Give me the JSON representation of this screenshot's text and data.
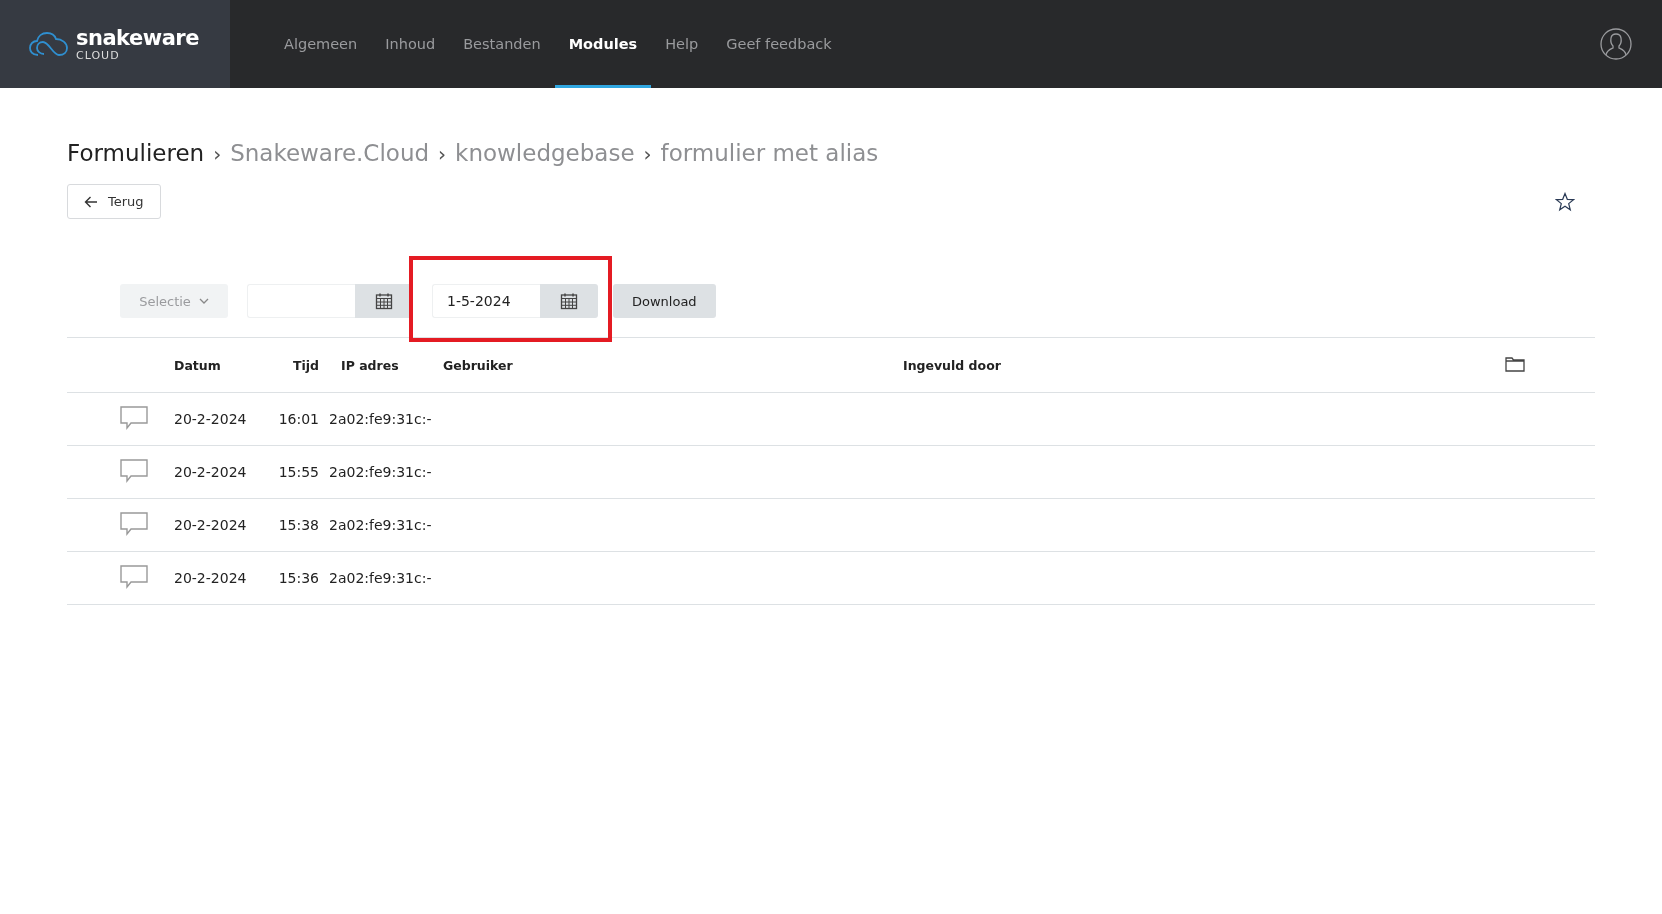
{
  "logo": {
    "name": "snakeware",
    "sub": "CLOUD"
  },
  "nav": [
    {
      "label": "Algemeen",
      "selected": false
    },
    {
      "label": "Inhoud",
      "selected": false
    },
    {
      "label": "Bestanden",
      "selected": false
    },
    {
      "label": "Modules",
      "selected": true
    },
    {
      "label": "Help",
      "selected": false
    },
    {
      "label": "Geef feedback",
      "selected": false
    }
  ],
  "breadcrumb": [
    {
      "label": "Formulieren",
      "current": true
    },
    {
      "label": "Snakeware.Cloud",
      "current": false
    },
    {
      "label": "knowledgebase",
      "current": false
    },
    {
      "label": "formulier met alias",
      "current": false
    }
  ],
  "breadcrumb_separator": "›",
  "back_button": "Terug",
  "favorite": false,
  "toolbar": {
    "selection": {
      "label": "Selectie",
      "disabled": true
    },
    "date_fields": [
      {
        "highlighted": false
      },
      {
        "value": "1-5-2024",
        "highlighted": true
      }
    ],
    "download": "Download"
  },
  "table": {
    "columns": [
      "Datum",
      "Tijd",
      "IP adres",
      "Gebruiker",
      "Ingevuld door"
    ],
    "rows": [
      {
        "datum": "20-2-2024",
        "tijd": "16:01",
        "ip": "2a02:fe9:31c:-"
      },
      {
        "datum": "20-2-2024",
        "tijd": "15:55",
        "ip": "2a02:fe9:31c:-"
      },
      {
        "datum": "20-2-2024",
        "tijd": "15:38",
        "ip": "2a02:fe9:31c:-"
      },
      {
        "datum": "20-2-2024",
        "tijd": "15:36",
        "ip": "2a02:fe9:31c:-"
      }
    ]
  }
}
